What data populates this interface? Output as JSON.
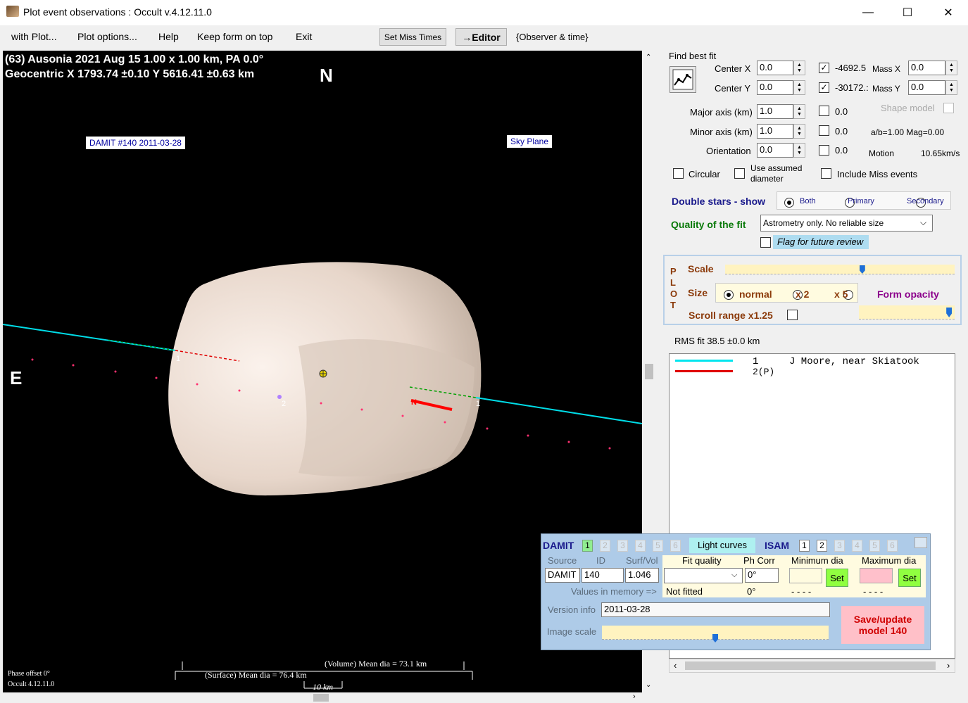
{
  "window": {
    "title": "Plot event observations : Occult v.4.12.11.0",
    "minimize": "—",
    "maximize": "☐",
    "close": "✕"
  },
  "menu": {
    "with_plot": "with Plot...",
    "plot_options": "Plot options...",
    "help": "Help",
    "keep_on_top": "Keep form on top",
    "exit": "Exit"
  },
  "toolbar": {
    "set_miss_times": "Set Miss Times",
    "editor": "→Editor",
    "observer_time": "{Observer & time}"
  },
  "plot": {
    "header_line1": "(63) Ausonia  2021 Aug 15   1.00 x 1.00 km, PA 0.0°",
    "header_line2": "Geocentric  X  1793.74 ±0.10  Y 5616.41 ±0.63 km",
    "north": "N",
    "east": "E",
    "damit_label": "DAMIT #140 2011-03-28",
    "sky_plane": "Sky Plane",
    "chord_labels": {
      "a": "1",
      "b": "2",
      "c": "1",
      "n": "N"
    },
    "volume_mean": "(Volume) Mean dia = 73.1 km",
    "surface_mean": "(Surface) Mean dia = 76.4 km",
    "scale_bar": "10 km",
    "phase_offset": "Phase offset 0°",
    "occult_version": "Occult 4.12.11.0"
  },
  "fit": {
    "find_best_fit": "Find best fit",
    "center_x_label": "Center X",
    "center_x": "0.0",
    "center_y_label": "Center Y",
    "center_y": "0.0",
    "x_val": "-4692.5",
    "mass_x_label": "Mass X",
    "mass_x": "0.0",
    "y_val": "-30172.:",
    "mass_y_label": "Mass Y",
    "mass_y": "0.0",
    "major_label": "Major axis (km)",
    "major": "1.0",
    "major_cb": "0.0",
    "minor_label": "Minor axis (km)",
    "minor": "1.0",
    "minor_cb": "0.0",
    "orient_label": "Orientation",
    "orient": "0.0",
    "orient_cb": "0.0",
    "shape_model": "Shape model",
    "ab_mag": "a/b=1.00  Mag=0.00",
    "motion_label": "Motion",
    "motion": "10.65km/s",
    "circular": "Circular",
    "use_assumed": "Use assumed diameter",
    "include_miss": "Include Miss events",
    "double_stars": "Double stars - show",
    "both": "Both",
    "primary": "Primary",
    "secondary": "Secondary",
    "quality_label": "Quality of the fit",
    "quality": "Astrometry only. No reliable size",
    "flag_review": "Flag for future review"
  },
  "plotbox": {
    "vlabel": [
      "P",
      "L",
      "O",
      "T"
    ],
    "scale": "Scale",
    "size": "Size",
    "normal": "normal",
    "x2": "x 2",
    "x5": "x 5",
    "form_opacity": "Form opacity",
    "scroll_range": "Scroll range x1.25",
    "scale_level": 0.6,
    "opacity_level": 0.97
  },
  "rms": "RMS fit 38.5 ±0.0 km",
  "observers": [
    {
      "num": "1",
      "name": "J Moore, near Skiatook",
      "color": "#00e5ee"
    },
    {
      "num": "2(P)",
      "name": "",
      "color": "#e00000"
    }
  ],
  "damit": {
    "title": "DAMIT",
    "tabs": [
      "1",
      "2",
      "3",
      "4",
      "5",
      "6"
    ],
    "light_curves": "Light curves",
    "isam": "ISAM",
    "isam_tabs": [
      "1",
      "2",
      "3",
      "4",
      "5",
      "6"
    ],
    "source_label": "Source",
    "id_label": "ID",
    "surf_vol_label": "Surf/Vol",
    "source": "DAMIT",
    "id": "140",
    "surf_vol": "1.046",
    "fit_quality": "Fit quality",
    "ph_corr": "Ph Corr",
    "min_dia": "Minimum dia",
    "max_dia": "Maximum dia",
    "ph_corr_val": "0°",
    "set": "Set",
    "values_in_memory": "Values in memory =>",
    "not_fitted": "Not fitted",
    "ph_mem": "0°",
    "dash_min": "- - - -",
    "dash_max": "- - - -",
    "version_label": "Version info",
    "version": "2011-03-28",
    "image_scale": "Image scale",
    "image_scale_level": 0.5,
    "save": "Save/update model 140"
  }
}
